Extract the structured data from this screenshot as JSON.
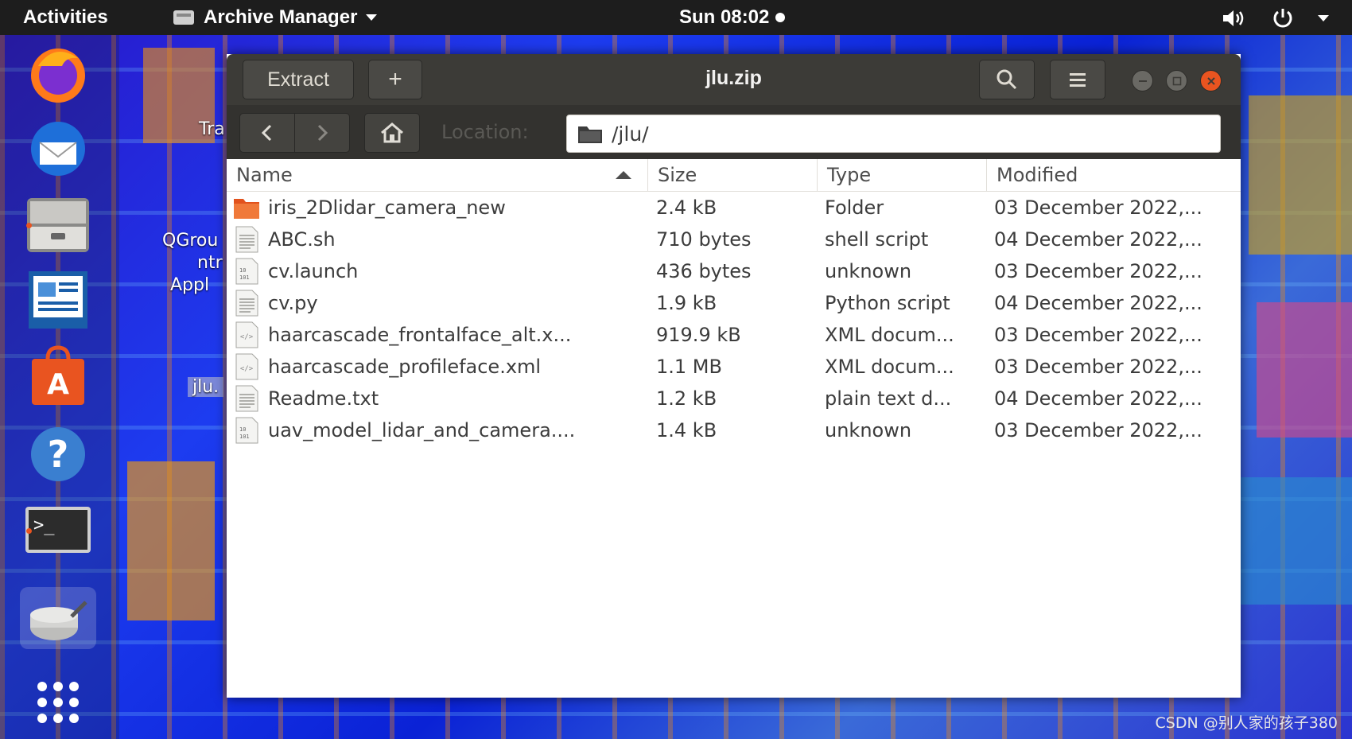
{
  "topbar": {
    "activities": "Activities",
    "app_name": "Archive Manager",
    "clock": "Sun 08:02"
  },
  "dock": {
    "items": [
      {
        "icon": "firefox-icon"
      },
      {
        "icon": "thunderbird-icon"
      },
      {
        "icon": "files-icon"
      },
      {
        "icon": "libreoffice-writer-icon"
      },
      {
        "icon": "ubuntu-software-icon"
      },
      {
        "icon": "help-icon"
      },
      {
        "icon": "terminal-icon"
      },
      {
        "icon": "archive-manager-icon"
      },
      {
        "icon": "show-applications-icon"
      }
    ]
  },
  "desktop": {
    "trash_label": "Tra",
    "app_label_line1": "QGrou",
    "app_label_line2": "ntr",
    "app_label_line3": "Appl",
    "zip_label": "jlu."
  },
  "window": {
    "title": "jlu.zip",
    "extract_label": "Extract",
    "add_label": "+",
    "location_label": "Location:",
    "path": "/jlu/",
    "columns": {
      "name": "Name",
      "size": "Size",
      "type": "Type",
      "modified": "Modified"
    },
    "files": [
      {
        "name": "iris_2Dlidar_camera_new",
        "size": "2.4 kB",
        "type": "Folder",
        "modified": "03 December 2022,...",
        "icon": "folder-icon"
      },
      {
        "name": "ABC.sh",
        "size": "710 bytes",
        "type": "shell script",
        "modified": "04 December 2022,...",
        "icon": "text-file-icon"
      },
      {
        "name": "cv.launch",
        "size": "436 bytes",
        "type": "unknown",
        "modified": "03 December 2022,...",
        "icon": "binary-file-icon"
      },
      {
        "name": "cv.py",
        "size": "1.9 kB",
        "type": "Python script",
        "modified": "04 December 2022,...",
        "icon": "text-file-icon"
      },
      {
        "name": "haarcascade_frontalface_alt.x...",
        "size": "919.9 kB",
        "type": "XML docum...",
        "modified": "03 December 2022,...",
        "icon": "xml-file-icon"
      },
      {
        "name": "haarcascade_profileface.xml",
        "size": "1.1 MB",
        "type": "XML docum...",
        "modified": "03 December 2022,...",
        "icon": "xml-file-icon"
      },
      {
        "name": "Readme.txt",
        "size": "1.2 kB",
        "type": "plain text d...",
        "modified": "04 December 2022,...",
        "icon": "text-file-icon"
      },
      {
        "name": "uav_model_lidar_and_camera....",
        "size": "1.4 kB",
        "type": "unknown",
        "modified": "03 December 2022,...",
        "icon": "binary-file-icon"
      }
    ]
  },
  "watermark": "CSDN @别人家的孩子380",
  "colors": {
    "accent": "#e95420",
    "headerbar": "#3c3b37",
    "topbar": "#1d1d1d"
  }
}
